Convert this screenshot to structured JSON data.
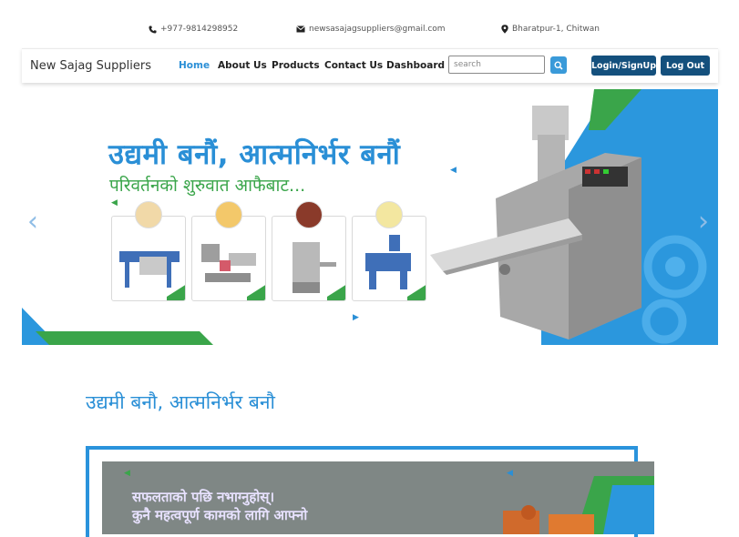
{
  "topbar": {
    "phone": "+977-9814298952",
    "email": "newsasajagsuppliers@gmail.com",
    "location": "Bharatpur-1, Chitwan"
  },
  "nav": {
    "brand": "New Sajag Suppliers",
    "links": [
      "Home",
      "About Us",
      "Products",
      "Contact Us",
      "Dashboard"
    ],
    "search_placeholder": "search",
    "login_label": "Login/SignUp",
    "logout_label": "Log Out"
  },
  "carousel": {
    "headline": "उद्यमी बनौं, आत्मनिर्भर बनौं",
    "subheadline": "परिवर्तनको शुरुवात आफैबाट...",
    "prev_arrow": "‹",
    "next_arrow": "›"
  },
  "section": {
    "title": "उद्यमी बनौ, आत्मनिर्भर बनौ",
    "quote_line1": "सफलताको पछि नभाग्नुहोस्।",
    "quote_line2": "कुनै महत्वपूर्ण कामको लागि आफ्नो"
  },
  "colors": {
    "accent_blue": "#2a8fd6",
    "accent_green": "#3aa54a",
    "button_navy": "#14507d"
  },
  "icons": [
    "phone-icon",
    "envelope-icon",
    "map-pin-icon",
    "search-icon"
  ]
}
